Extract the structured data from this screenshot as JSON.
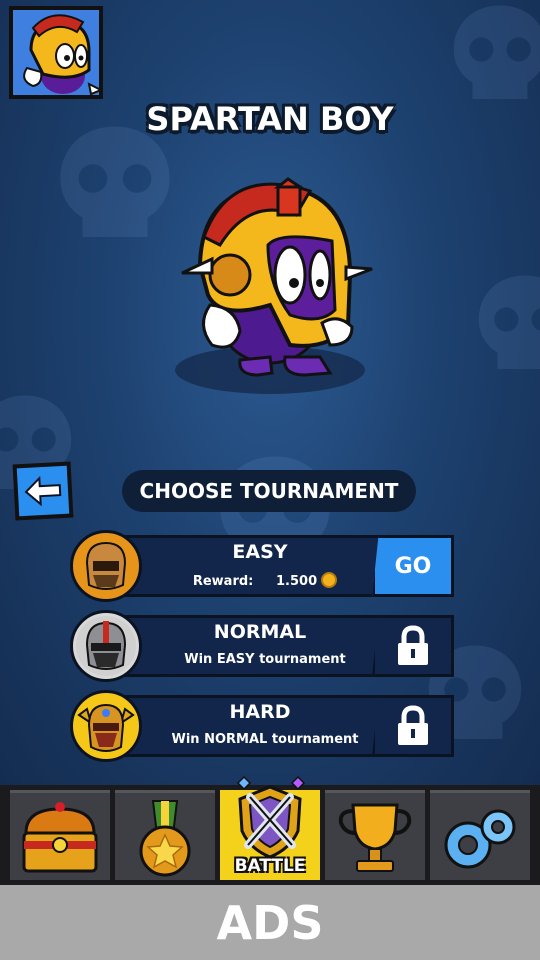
{
  "character": {
    "name": "SPARTAN BOY"
  },
  "tournament": {
    "heading": "CHOOSE TOURNAMENT",
    "rows": [
      {
        "name": "EASY",
        "reward_label": "Reward:",
        "reward_value": "1.500",
        "action_label": "GO"
      },
      {
        "name": "NORMAL",
        "requirement": "Win EASY tournament"
      },
      {
        "name": "HARD",
        "requirement": "Win NORMAL tournament"
      }
    ]
  },
  "nav": {
    "items": [
      {
        "icon": "treasure-chest-icon"
      },
      {
        "icon": "medal-icon"
      },
      {
        "icon": "battle-shield-icon",
        "label": "BATTLE",
        "active": true
      },
      {
        "icon": "trophy-icon"
      },
      {
        "icon": "gears-icon"
      }
    ]
  },
  "ads": {
    "label": "ADS"
  },
  "colors": {
    "accent_blue": "#2b8ff0",
    "nav_active": "#f4d21b",
    "panel": "#12254a"
  }
}
